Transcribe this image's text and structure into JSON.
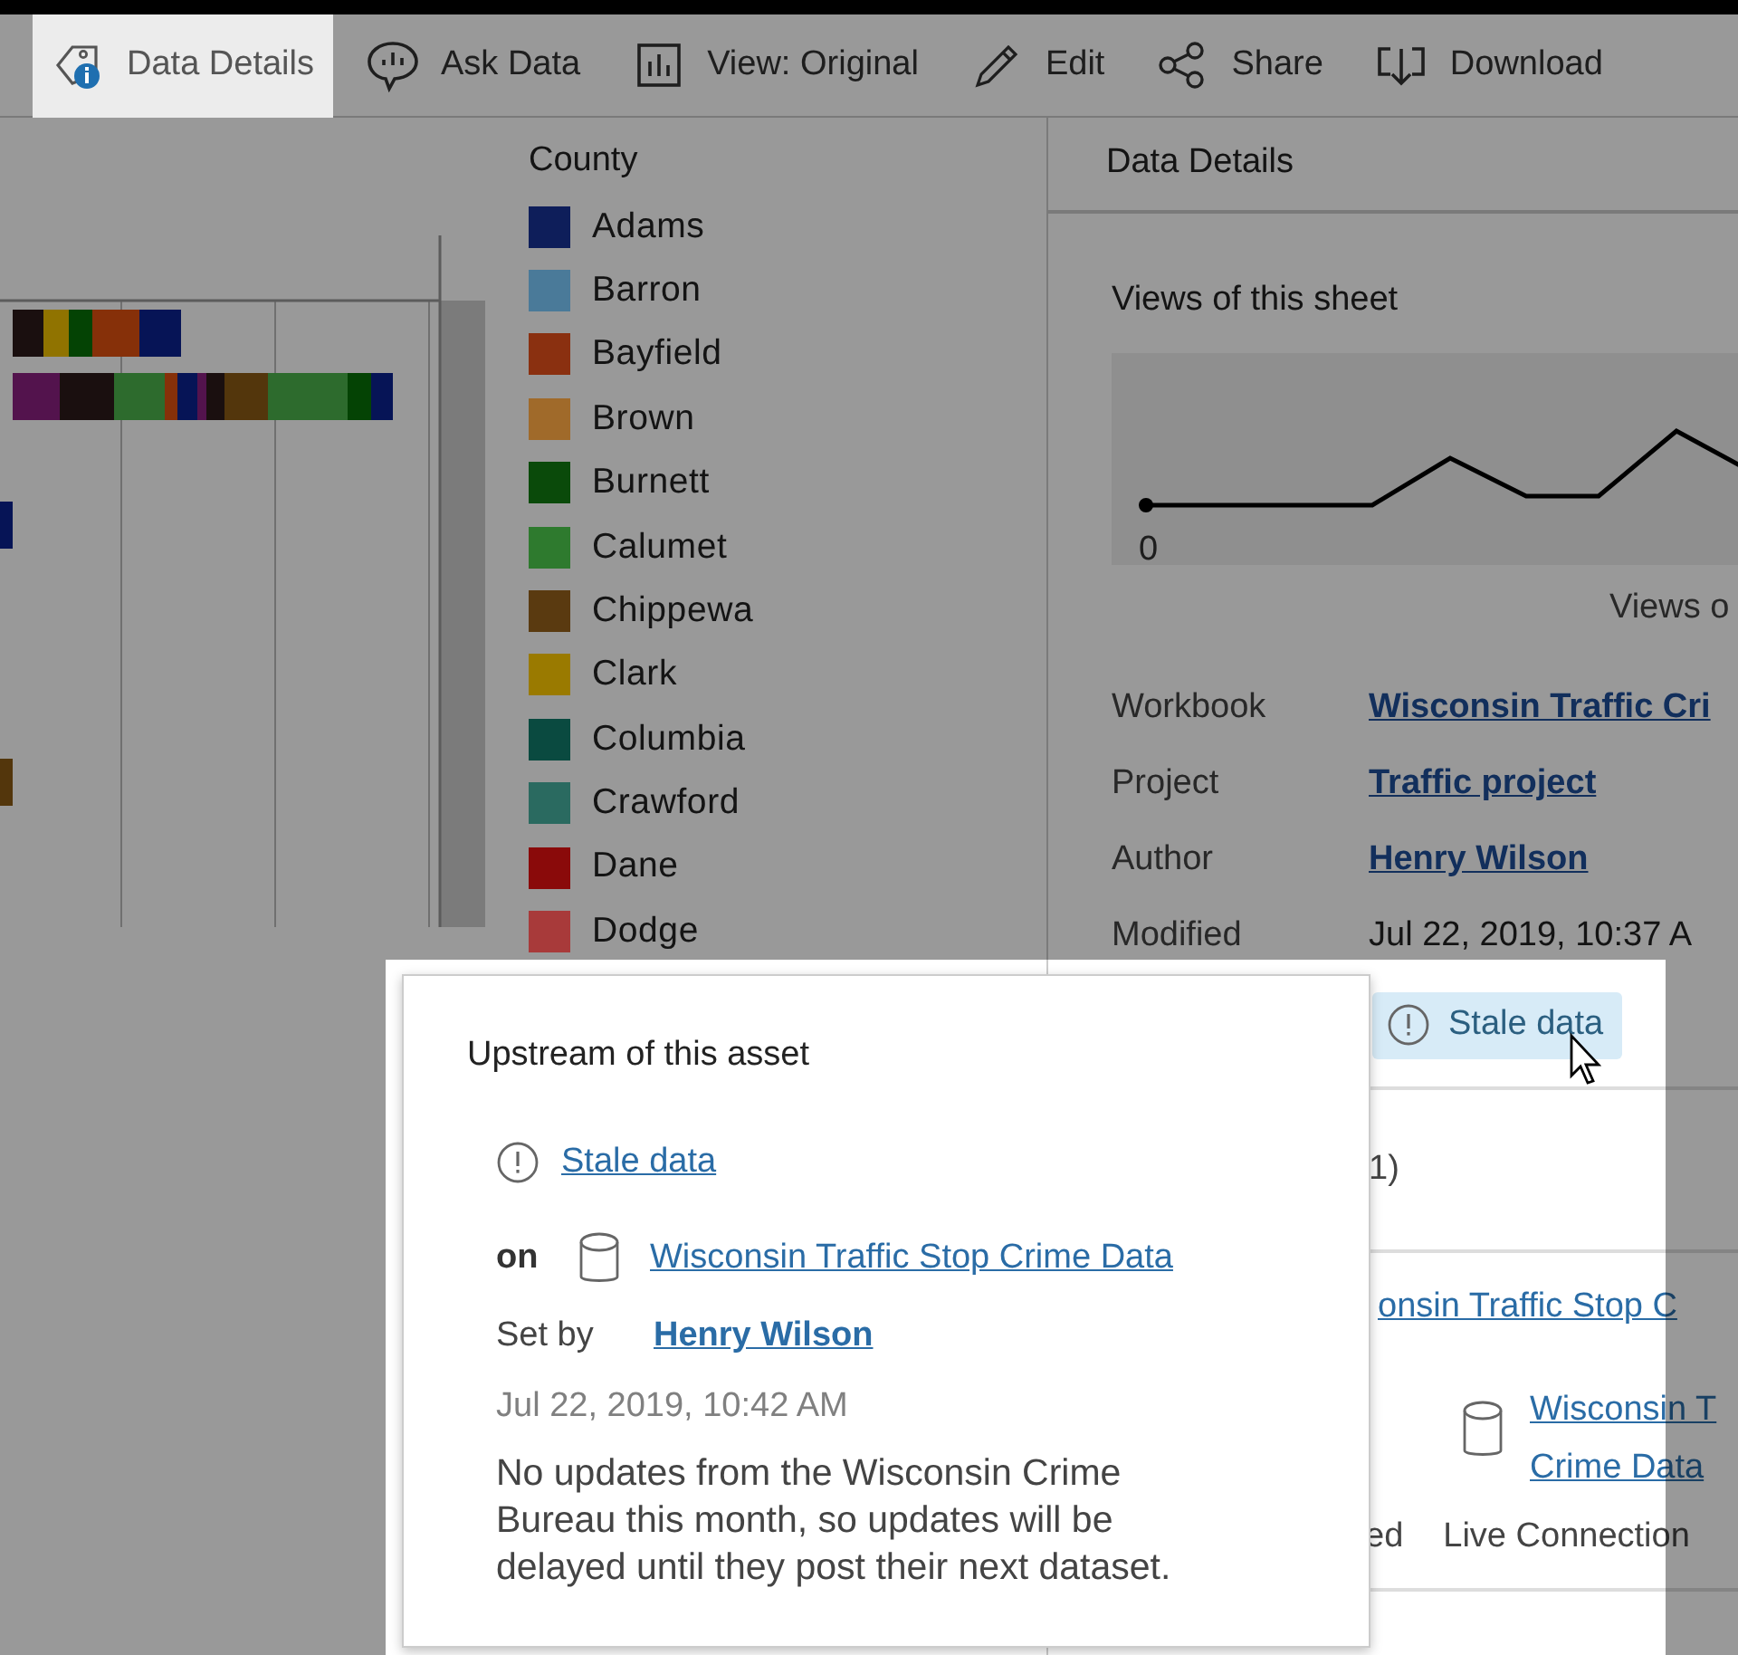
{
  "toolbar": {
    "items": [
      {
        "label": "Data Details",
        "kind": "tag-info",
        "selected": true
      },
      {
        "label": "Ask Data",
        "kind": "bubble",
        "selected": false
      },
      {
        "label": "View: Original",
        "kind": "bars",
        "selected": false
      },
      {
        "label": "Edit",
        "kind": "pencil",
        "selected": false
      },
      {
        "label": "Share",
        "kind": "share",
        "selected": false
      },
      {
        "label": "Download",
        "kind": "download",
        "selected": false
      }
    ]
  },
  "legend": {
    "title": "County",
    "items": [
      {
        "label": "Adams",
        "color": "#0e1e5a"
      },
      {
        "label": "Barron",
        "color": "#4a7a99"
      },
      {
        "label": "Bayfield",
        "color": "#8a3010"
      },
      {
        "label": "Brown",
        "color": "#a06a2a"
      },
      {
        "label": "Burnett",
        "color": "#0a4a0a"
      },
      {
        "label": "Calumet",
        "color": "#2e7a2e"
      },
      {
        "label": "Chippewa",
        "color": "#5a3a10"
      },
      {
        "label": "Clark",
        "color": "#9a7a00"
      },
      {
        "label": "Columbia",
        "color": "#0a4a40"
      },
      {
        "label": "Crawford",
        "color": "#2a6a60"
      },
      {
        "label": "Dane",
        "color": "#8a0a0a"
      },
      {
        "label": "Dodge",
        "color": "#a83a3a"
      }
    ]
  },
  "details_panel": {
    "title": "Data Details",
    "views_title": "Views of this sheet",
    "sparkline_label": "0",
    "sparkline_caption": "Views o",
    "fields": [
      {
        "label": "Workbook",
        "value": "Wisconsin Traffic Cri",
        "kind": "link"
      },
      {
        "label": "Project",
        "value": "Traffic project",
        "kind": "link"
      },
      {
        "label": "Author",
        "value": "Henry Wilson",
        "kind": "link"
      },
      {
        "label": "Modified",
        "value": "Jul 22, 2019, 10:37 A",
        "kind": "text"
      }
    ],
    "quality_warning": "Stale data",
    "upstream_count": "1)",
    "upstream_asset": "onsin Traffic Stop C",
    "datasource_lines": [
      "Wisconsin T",
      "Crime Data"
    ],
    "status_fragment": "ed",
    "connection": "Live Connection"
  },
  "popup": {
    "title": "Upstream of this asset",
    "warning": "Stale data",
    "on_label": "on",
    "asset": "Wisconsin Traffic Stop Crime Data",
    "set_by_label": "Set by",
    "set_by": "Henry Wilson",
    "timestamp": "Jul 22, 2019, 10:42 AM",
    "message": "No updates from the Wisconsin Crime Bureau this month, so updates will be delayed until they post their next dataset."
  }
}
